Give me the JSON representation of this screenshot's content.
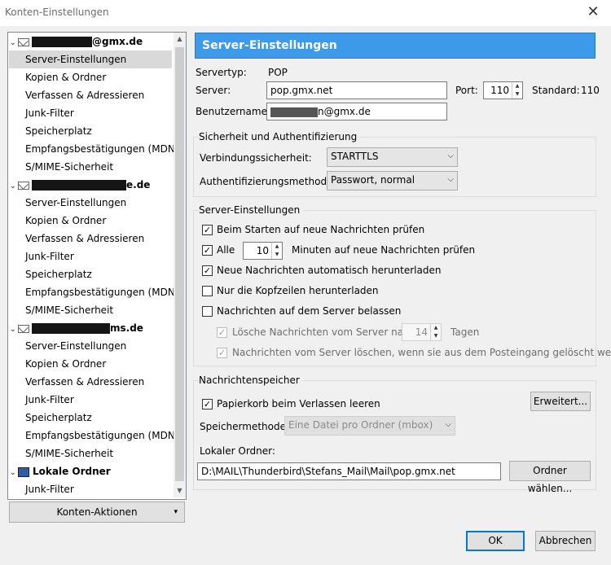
{
  "window": {
    "title": "Konten-Einstellungen",
    "close_glyph": "✕"
  },
  "tree": {
    "accounts": [
      {
        "name": "@gmx.de",
        "icon": "envelope-icon",
        "items": [
          "Server-Einstellungen",
          "Kopien & Ordner",
          "Verfassen & Adressieren",
          "Junk-Filter",
          "Speicherplatz",
          "Empfangsbestätigungen (MDN)",
          "S/MIME-Sicherheit"
        ]
      },
      {
        "name": "e.de",
        "icon": "envelope-icon",
        "items": [
          "Server-Einstellungen",
          "Kopien & Ordner",
          "Verfassen & Adressieren",
          "Junk-Filter",
          "Speicherplatz",
          "Empfangsbestätigungen (MDN)",
          "S/MIME-Sicherheit"
        ]
      },
      {
        "name": "ms.de",
        "icon": "envelope-icon",
        "items": [
          "Server-Einstellungen",
          "Kopien & Ordner",
          "Verfassen & Adressieren",
          "Junk-Filter",
          "Speicherplatz",
          "Empfangsbestätigungen (MDN)",
          "S/MIME-Sicherheit"
        ]
      },
      {
        "name": "Lokale Ordner",
        "icon": "monitor-icon",
        "items": [
          "Junk-Filter"
        ]
      }
    ],
    "selected": "Server-Einstellungen"
  },
  "account_actions": {
    "label": "Konten-Aktionen",
    "arrow": "▾"
  },
  "panel": {
    "header": "Server-Einstellungen",
    "servertype_label": "Servertyp:",
    "servertype_value": "POP",
    "server_label": "Server:",
    "server_value": "pop.gmx.net",
    "port_label": "Port:",
    "port_value": "110",
    "standard_label": "Standard:",
    "standard_value": "110",
    "username_label": "Benutzername:",
    "username_value": "n@gmx.de",
    "security": {
      "title": "Sicherheit und Authentifizierung",
      "conn_label": "Verbindungssicherheit:",
      "conn_value": "STARTTLS",
      "auth_label": "Authentifizierungsmethode:",
      "auth_value": "Passwort, normal"
    },
    "server_settings": {
      "title": "Server-Einstellungen",
      "check_new": "Beim Starten auf neue Nachrichten prüfen",
      "every_label": "Alle",
      "every_value": "10",
      "every_suffix": "Minuten auf neue Nachrichten prüfen",
      "auto_download": "Neue Nachrichten automatisch herunterladen",
      "headers_only": "Nur die Kopfzeilen herunterladen",
      "leave_on_server": "Nachrichten auf dem Server belassen",
      "delete_after_label": "Lösche Nachrichten vom Server nach",
      "delete_after_value": "14",
      "delete_after_suffix": "Tagen",
      "delete_when_deleted": "Nachrichten vom Server löschen, wenn sie aus dem Posteingang gelöscht werden"
    },
    "storage": {
      "title": "Nachrichtenspeicher",
      "empty_trash": "Papierkorb beim Verlassen leeren",
      "advanced_button": "Erweitert...",
      "method_label": "Speichermethode:",
      "method_value": "Eine Datei pro Ordner (mbox)",
      "local_folder_label": "Lokaler Ordner:",
      "local_folder_value": "D:\\MAIL\\Thunderbird\\Stefans_Mail\\Mail\\pop.gmx.net",
      "choose_folder_button": "Ordner wählen..."
    }
  },
  "footer": {
    "ok": "OK",
    "cancel": "Abbrechen"
  },
  "icons": {
    "check": "✓",
    "dropdown": "⌵",
    "up": "▲",
    "down": "▼"
  }
}
